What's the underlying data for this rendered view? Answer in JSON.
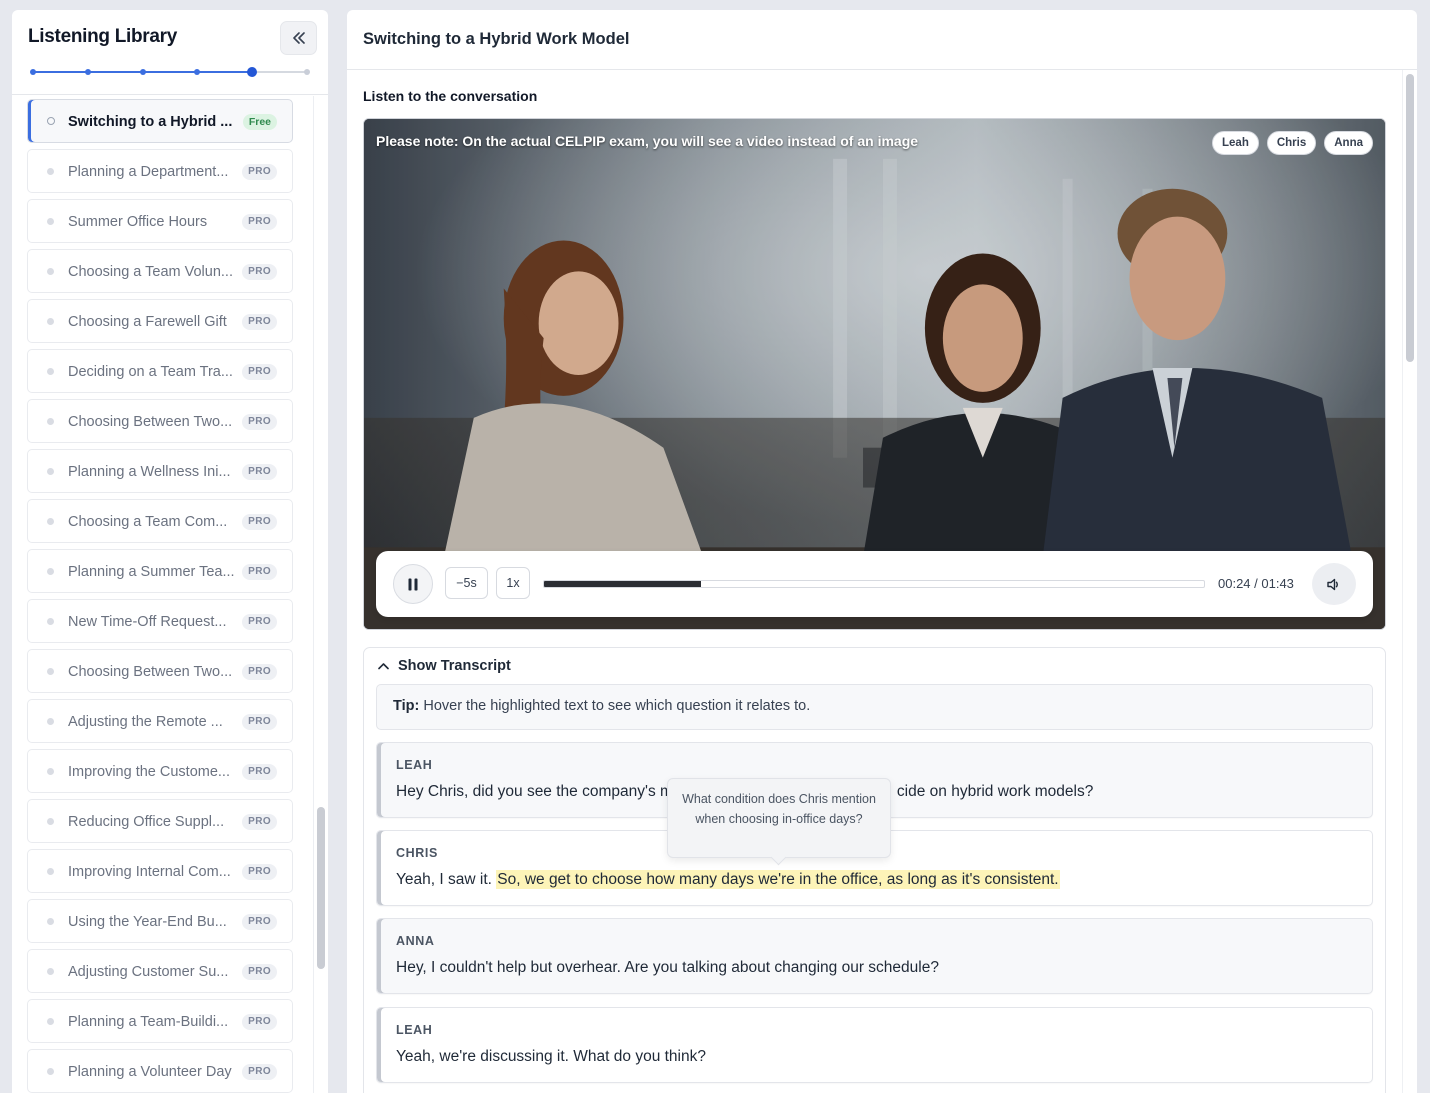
{
  "sidebar": {
    "title": "Listening Library",
    "collapse_icon": "double-chevron-left-icon",
    "progress_steps": 6,
    "progress_current_step": 5,
    "lessons": [
      {
        "title": "Switching to a Hybrid ...",
        "badge": "Free"
      },
      {
        "title": "Planning a Department...",
        "badge": "PRO"
      },
      {
        "title": "Summer Office Hours",
        "badge": "PRO"
      },
      {
        "title": "Choosing a Team Volun...",
        "badge": "PRO"
      },
      {
        "title": "Choosing a Farewell Gift",
        "badge": "PRO"
      },
      {
        "title": "Deciding on a Team Tra...",
        "badge": "PRO"
      },
      {
        "title": "Choosing Between Two...",
        "badge": "PRO"
      },
      {
        "title": "Planning a Wellness Ini...",
        "badge": "PRO"
      },
      {
        "title": "Choosing a Team Com...",
        "badge": "PRO"
      },
      {
        "title": "Planning a Summer Tea...",
        "badge": "PRO"
      },
      {
        "title": "New Time-Off Request...",
        "badge": "PRO"
      },
      {
        "title": "Choosing Between Two...",
        "badge": "PRO"
      },
      {
        "title": "Adjusting the Remote ...",
        "badge": "PRO"
      },
      {
        "title": "Improving the Custome...",
        "badge": "PRO"
      },
      {
        "title": "Reducing Office Suppl...",
        "badge": "PRO"
      },
      {
        "title": "Improving Internal Com...",
        "badge": "PRO"
      },
      {
        "title": "Using the Year-End Bu...",
        "badge": "PRO"
      },
      {
        "title": "Adjusting Customer Su...",
        "badge": "PRO"
      },
      {
        "title": "Planning a Team-Buildi...",
        "badge": "PRO"
      },
      {
        "title": "Planning a Volunteer Day",
        "badge": "PRO"
      }
    ]
  },
  "main": {
    "title": "Switching to a Hybrid Work Model",
    "section_label": "Listen to the conversation",
    "video": {
      "note": "Please note: On the actual CELPIP exam, you will see a video instead of an image",
      "speakers": [
        "Leah",
        "Chris",
        "Anna"
      ]
    },
    "player": {
      "state_icon": "pause-icon",
      "rewind_label": "−5s",
      "speed_label": "1x",
      "progress_fraction": 0.238,
      "time": "00:24 / 01:43",
      "volume_icon": "speaker-volume-icon"
    },
    "transcript": {
      "toggle_label": "Show Transcript",
      "tip_label": "Tip:",
      "tip_text": " Hover the highlighted text to see which question it relates to.",
      "turns": [
        {
          "speaker": "LEAH",
          "before": "Hey Chris, did you see the company's m",
          "hidden_part": "",
          "after": "cide on hybrid work models?"
        },
        {
          "speaker": "CHRIS",
          "before": "Yeah, I saw it. ",
          "highlight": "So, we get to choose how many days we're in the office, as long as it's consistent."
        },
        {
          "speaker": "ANNA",
          "text": "Hey, I couldn't help but overhear. Are you talking about changing our schedule?"
        },
        {
          "speaker": "LEAH",
          "text": "Yeah, we're discussing it. What do you think?"
        }
      ],
      "tooltip": "What condition does Chris mention when choosing in-office days?"
    }
  },
  "colors": {
    "accent": "#3b6ee0",
    "highlight": "#fdf4b8",
    "free_badge": "#2f8a4e"
  }
}
